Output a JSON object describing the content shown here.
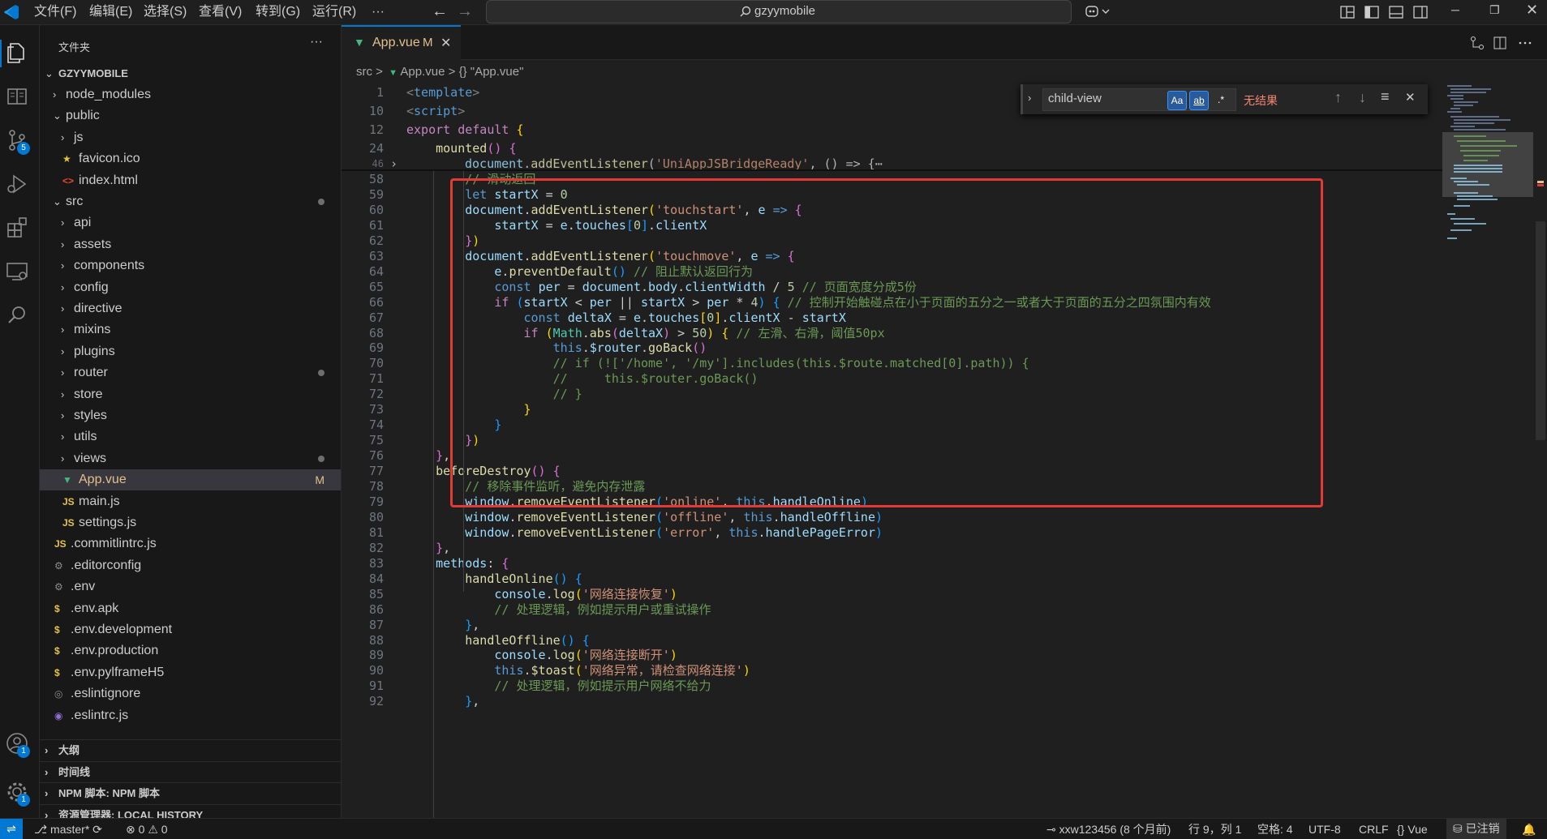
{
  "menu": [
    "文件(F)",
    "编辑(E)",
    "选择(S)",
    "查看(V)",
    "转到(G)",
    "运行(R)",
    "···"
  ],
  "search_text": "gzyymobile",
  "sidebar": {
    "title": "文件夹",
    "more": "···",
    "root": "GZYYMOBILE",
    "items": [
      {
        "label": "node_modules",
        "depth": 1,
        "kind": "folder",
        "open": false
      },
      {
        "label": "public",
        "depth": 1,
        "kind": "folder",
        "open": true
      },
      {
        "label": "js",
        "depth": 2,
        "kind": "folder",
        "open": false
      },
      {
        "label": "favicon.ico",
        "depth": 2,
        "kind": "star"
      },
      {
        "label": "index.html",
        "depth": 2,
        "kind": "html"
      },
      {
        "label": "src",
        "depth": 1,
        "kind": "folder",
        "open": true,
        "dot": true
      },
      {
        "label": "api",
        "depth": 2,
        "kind": "folder",
        "open": false
      },
      {
        "label": "assets",
        "depth": 2,
        "kind": "folder",
        "open": false
      },
      {
        "label": "components",
        "depth": 2,
        "kind": "folder",
        "open": false
      },
      {
        "label": "config",
        "depth": 2,
        "kind": "folder",
        "open": false
      },
      {
        "label": "directive",
        "depth": 2,
        "kind": "folder",
        "open": false
      },
      {
        "label": "mixins",
        "depth": 2,
        "kind": "folder",
        "open": false
      },
      {
        "label": "plugins",
        "depth": 2,
        "kind": "folder",
        "open": false
      },
      {
        "label": "router",
        "depth": 2,
        "kind": "folder",
        "open": false,
        "dot": true
      },
      {
        "label": "store",
        "depth": 2,
        "kind": "folder",
        "open": false
      },
      {
        "label": "styles",
        "depth": 2,
        "kind": "folder",
        "open": false
      },
      {
        "label": "utils",
        "depth": 2,
        "kind": "folder",
        "open": false
      },
      {
        "label": "views",
        "depth": 2,
        "kind": "folder",
        "open": false,
        "dot": true
      },
      {
        "label": "App.vue",
        "depth": 2,
        "kind": "vue",
        "status": "M",
        "selected": true
      },
      {
        "label": "main.js",
        "depth": 2,
        "kind": "js"
      },
      {
        "label": "settings.js",
        "depth": 2,
        "kind": "js"
      },
      {
        "label": ".commitlintrc.js",
        "depth": 1,
        "kind": "js"
      },
      {
        "label": ".editorconfig",
        "depth": 1,
        "kind": "gear"
      },
      {
        "label": ".env",
        "depth": 1,
        "kind": "gear"
      },
      {
        "label": ".env.apk",
        "depth": 1,
        "kind": "dollar"
      },
      {
        "label": ".env.development",
        "depth": 1,
        "kind": "dollar"
      },
      {
        "label": ".env.production",
        "depth": 1,
        "kind": "dollar"
      },
      {
        "label": ".env.pylframeH5",
        "depth": 1,
        "kind": "dollar"
      },
      {
        "label": ".eslintignore",
        "depth": 1,
        "kind": "circle"
      },
      {
        "label": ".eslintrc.js",
        "depth": 1,
        "kind": "eslint"
      }
    ],
    "sections": [
      "大纲",
      "时间线",
      "NPM 脚本: NPM 脚本",
      "资源管理器: LOCAL HISTORY"
    ]
  },
  "tab": {
    "label": "App.vue",
    "status": "M"
  },
  "breadcrumb": [
    "src",
    ">",
    "App.vue",
    ">",
    "{} \"App.vue\""
  ],
  "find": {
    "value": "child-view",
    "case": "Aa",
    "word": "ab",
    "regex": ".*",
    "result": "无结果"
  },
  "activity_badges": {
    "scm": "5",
    "accounts": "1",
    "settings": "1"
  },
  "sticky": [
    {
      "n": "1",
      "h": "<span class=\"tag\">&lt;</span><span class=\"tg\">template</span><span class=\"tag\">&gt;</span>"
    },
    {
      "n": "10",
      "h": "<span class=\"tag\">&lt;</span><span class=\"tg\">script</span><span class=\"tag\">&gt;</span>"
    },
    {
      "n": "12",
      "h": "<span class=\"kc\">export</span> <span class=\"kc\">default</span> <span class=\"br\">{</span>"
    },
    {
      "n": "24",
      "h": "    <span class=\"fn\">mounted</span><span class=\"br2\">()</span> <span class=\"br2\">{</span>"
    }
  ],
  "lines": [
    {
      "n": "58",
      "h": "        <span class=\"cm\">// 滑动返回</span>"
    },
    {
      "n": "59",
      "h": "        <span class=\"kw\">let</span> <span class=\"var\">startX</span> = <span class=\"num\">0</span>"
    },
    {
      "n": "60",
      "h": "        <span class=\"var\">document</span>.<span class=\"fn\">addEventListener</span><span class=\"br\">(</span><span class=\"str\">'touchstart'</span>, <span class=\"var\">e</span> <span class=\"kw\">=&gt;</span> <span class=\"br2\">{</span>"
    },
    {
      "n": "61",
      "h": "            <span class=\"var\">startX</span> = <span class=\"var\">e</span>.<span class=\"var\">touches</span><span class=\"br3\">[</span><span class=\"num\">0</span><span class=\"br3\">]</span>.<span class=\"var\">clientX</span>"
    },
    {
      "n": "62",
      "h": "        <span class=\"br2\">}</span><span class=\"br\">)</span>"
    },
    {
      "n": "63",
      "h": "        <span class=\"var\">document</span>.<span class=\"fn\">addEventListener</span><span class=\"br\">(</span><span class=\"str\">'touchmove'</span>, <span class=\"var\">e</span> <span class=\"kw\">=&gt;</span> <span class=\"br2\">{</span>"
    },
    {
      "n": "64",
      "h": "            <span class=\"var\">e</span>.<span class=\"fn\">preventDefault</span><span class=\"br3\">()</span> <span class=\"cm\">// 阻止默认返回行为</span>"
    },
    {
      "n": "65",
      "h": "            <span class=\"kw\">const</span> <span class=\"var\">per</span> = <span class=\"var\">document</span>.<span class=\"var\">body</span>.<span class=\"var\">clientWidth</span> / <span class=\"num\">5</span> <span class=\"cm\">// 页面宽度分成5份</span>"
    },
    {
      "n": "66",
      "h": "            <span class=\"kc\">if</span> <span class=\"br3\">(</span><span class=\"var\">startX</span> &lt; <span class=\"var\">per</span> || <span class=\"var\">startX</span> &gt; <span class=\"var\">per</span> * <span class=\"num\">4</span><span class=\"br3\">)</span> <span class=\"br3\">{</span> <span class=\"cm\">// 控制开始触碰点在小于页面的五分之一或者大于页面的五分之四氛围内有效</span>"
    },
    {
      "n": "67",
      "h": "                <span class=\"kw\">const</span> <span class=\"var\">deltaX</span> = <span class=\"var\">e</span>.<span class=\"var\">touches</span><span class=\"br\">[</span><span class=\"num\">0</span><span class=\"br\">]</span>.<span class=\"var\">clientX</span> - <span class=\"var\">startX</span>"
    },
    {
      "n": "68",
      "h": "                <span class=\"kc\">if</span> <span class=\"br\">(</span><span class=\"cls\">Math</span>.<span class=\"fn\">abs</span><span class=\"br2\">(</span><span class=\"var\">deltaX</span><span class=\"br2\">)</span> &gt; <span class=\"num\">50</span><span class=\"br\">)</span> <span class=\"br\">{</span> <span class=\"cm\">// 左滑、右滑，阈值50px</span>"
    },
    {
      "n": "69",
      "h": "                    <span class=\"kw\">this</span>.<span class=\"var\">$router</span>.<span class=\"fn\">goBack</span><span class=\"br2\">()</span>"
    },
    {
      "n": "70",
      "h": "                    <span class=\"cm\">// if (!['/home', '/my'].includes(this.$route.matched[0].path)) {</span>"
    },
    {
      "n": "71",
      "h": "                    <span class=\"cm\">//     this.$router.goBack()</span>"
    },
    {
      "n": "72",
      "h": "                    <span class=\"cm\">// }</span>"
    },
    {
      "n": "73",
      "h": "                <span class=\"br\">}</span>"
    },
    {
      "n": "74",
      "h": "            <span class=\"br3\">}</span>"
    },
    {
      "n": "75",
      "h": "        <span class=\"br2\">}</span><span class=\"br\">)</span>"
    },
    {
      "n": "76",
      "h": "    <span class=\"br2\">}</span>,"
    },
    {
      "n": "77",
      "h": "    <span class=\"fn\">beforeDestroy</span><span class=\"br2\">()</span> <span class=\"br2\">{</span>"
    },
    {
      "n": "78",
      "h": "        <span class=\"cm\">// 移除事件监听，避免内存泄露</span>"
    },
    {
      "n": "79",
      "h": "        <span class=\"var\">window</span>.<span class=\"fn\">removeEventListener</span><span class=\"br3\">(</span><span class=\"str\">'online'</span>, <span class=\"kw\">this</span>.<span class=\"var\">handleOnline</span><span class=\"br3\">)</span>"
    },
    {
      "n": "80",
      "h": "        <span class=\"var\">window</span>.<span class=\"fn\">removeEventListener</span><span class=\"br3\">(</span><span class=\"str\">'offline'</span>, <span class=\"kw\">this</span>.<span class=\"var\">handleOffline</span><span class=\"br3\">)</span>"
    },
    {
      "n": "81",
      "h": "        <span class=\"var\">window</span>.<span class=\"fn\">removeEventListener</span><span class=\"br3\">(</span><span class=\"str\">'error'</span>, <span class=\"kw\">this</span>.<span class=\"var\">handlePageError</span><span class=\"br3\">)</span>"
    },
    {
      "n": "82",
      "h": "    <span class=\"br2\">}</span>,"
    },
    {
      "n": "83",
      "h": "    <span class=\"var\">methods</span>: <span class=\"br2\">{</span>"
    },
    {
      "n": "84",
      "h": "        <span class=\"fn\">handleOnline</span><span class=\"br3\">()</span> <span class=\"br3\">{</span>"
    },
    {
      "n": "85",
      "h": "            <span class=\"var\">console</span>.<span class=\"fn\">log</span><span class=\"br\">(</span><span class=\"str\">'网络连接恢复'</span><span class=\"br\">)</span>"
    },
    {
      "n": "86",
      "h": "            <span class=\"cm\">// 处理逻辑，例如提示用户或重试操作</span>"
    },
    {
      "n": "87",
      "h": "        <span class=\"br3\">}</span>,"
    },
    {
      "n": "88",
      "h": "        <span class=\"fn\">handleOffline</span><span class=\"br3\">()</span> <span class=\"br3\">{</span>"
    },
    {
      "n": "89",
      "h": "            <span class=\"var\">console</span>.<span class=\"fn\">log</span><span class=\"br\">(</span><span class=\"str\">'网络连接断开'</span><span class=\"br\">)</span>"
    },
    {
      "n": "90",
      "h": "            <span class=\"kw\">this</span>.<span class=\"fn\">$toast</span><span class=\"br\">(</span><span class=\"str\">'网络异常，请检查网络连接'</span><span class=\"br\">)</span>"
    },
    {
      "n": "91",
      "h": "            <span class=\"cm\">// 处理逻辑，例如提示用户网络不给力</span>"
    },
    {
      "n": "92",
      "h": "        <span class=\"br3\">}</span>,"
    }
  ],
  "status": {
    "branch": "master*",
    "sync": "⟳",
    "errors": "0",
    "warnings": "0",
    "blame": "xxw123456 (8 个月前)",
    "position": "行 9，列 1",
    "spaces": "空格: 4",
    "encoding": "UTF-8",
    "eol": "CRLF",
    "language": "Vue",
    "account": "已注销"
  }
}
